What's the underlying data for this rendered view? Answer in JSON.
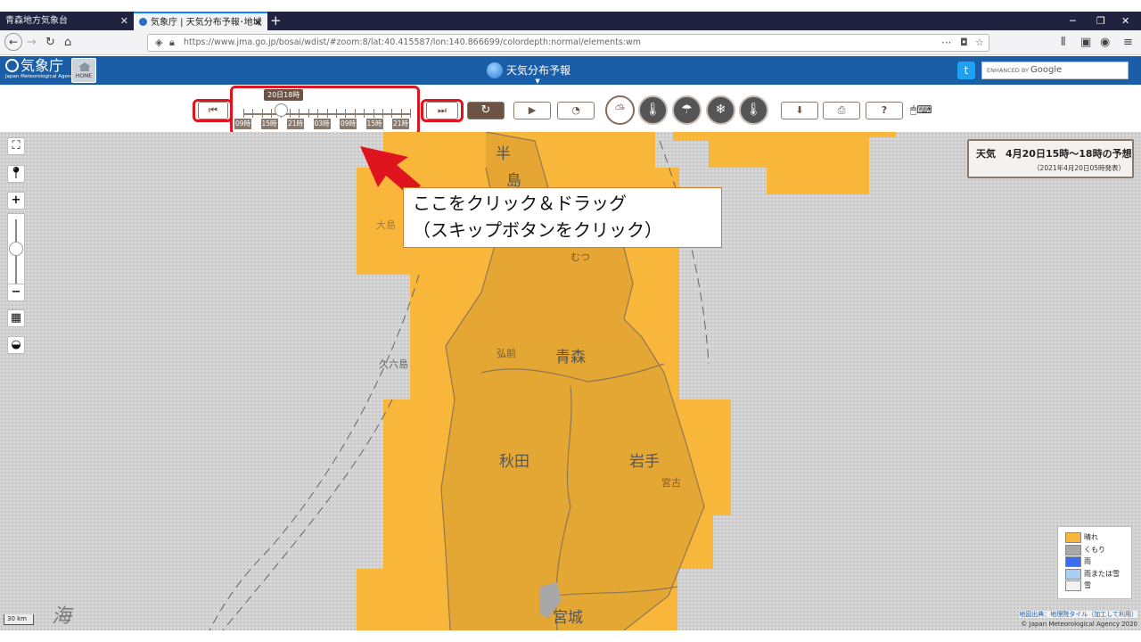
{
  "browser": {
    "tab1_title": "青森地方気象台",
    "tab2_title": "気象庁 | 天気分布予報･地域時",
    "url_host": "https://www.jma.go.jp",
    "url_path": "/bosai/wdist/#zoom:8/lat:40.415587/lon:140.866699/colordepth:normal/elements:wm"
  },
  "header": {
    "logo_text": "気象庁",
    "logo_sub": "Japan Meteorological Agency",
    "home_label": "HOME",
    "app_title": "天気分布予報",
    "search_brand_prefix": "ENHANCED BY",
    "search_brand": "Google"
  },
  "timeline": {
    "current_label": "20日18時",
    "tick_labels": [
      "09時",
      "15時",
      "21時",
      "03時",
      "09時",
      "15時",
      "21時"
    ],
    "position_fraction": 0.17
  },
  "infobox": {
    "title": "天気　4月20日15時～18時の予想",
    "issued": "（2021年4月20日05時発表）"
  },
  "legend": {
    "items": [
      {
        "label": "晴れ",
        "color": "#f8b63a"
      },
      {
        "label": "くもり",
        "color": "#a8a8a8"
      },
      {
        "label": "雨",
        "color": "#3c6cf0"
      },
      {
        "label": "雨または雪",
        "color": "#a9d0f2"
      },
      {
        "label": "雪",
        "color": "#f2f2f2"
      }
    ]
  },
  "map": {
    "scale_label": "30 km",
    "attribution_1": "地図出典：地理院タイル（加工して利用）",
    "attribution_2": "© Japan Meteorological Agency 2020",
    "place_labels": {
      "aomori": "青森",
      "akita": "秋田",
      "iwate": "岩手",
      "miyagi": "宮城",
      "hirosaki": "弘前",
      "miyako": "宮古",
      "shimo": "半",
      "shima": "島",
      "oshima": "大島",
      "mutsu": "むつ",
      "kuroshima": "久六島",
      "sea": "海"
    }
  },
  "callout": {
    "line1": "ここをクリック＆ドラッグ",
    "line2": "（スキップボタンをクリック）"
  },
  "colors": {
    "accent": "#1a5ea8",
    "sunny": "#f8b63a",
    "brown": "#6b5446",
    "highlight": "#e0141e"
  }
}
